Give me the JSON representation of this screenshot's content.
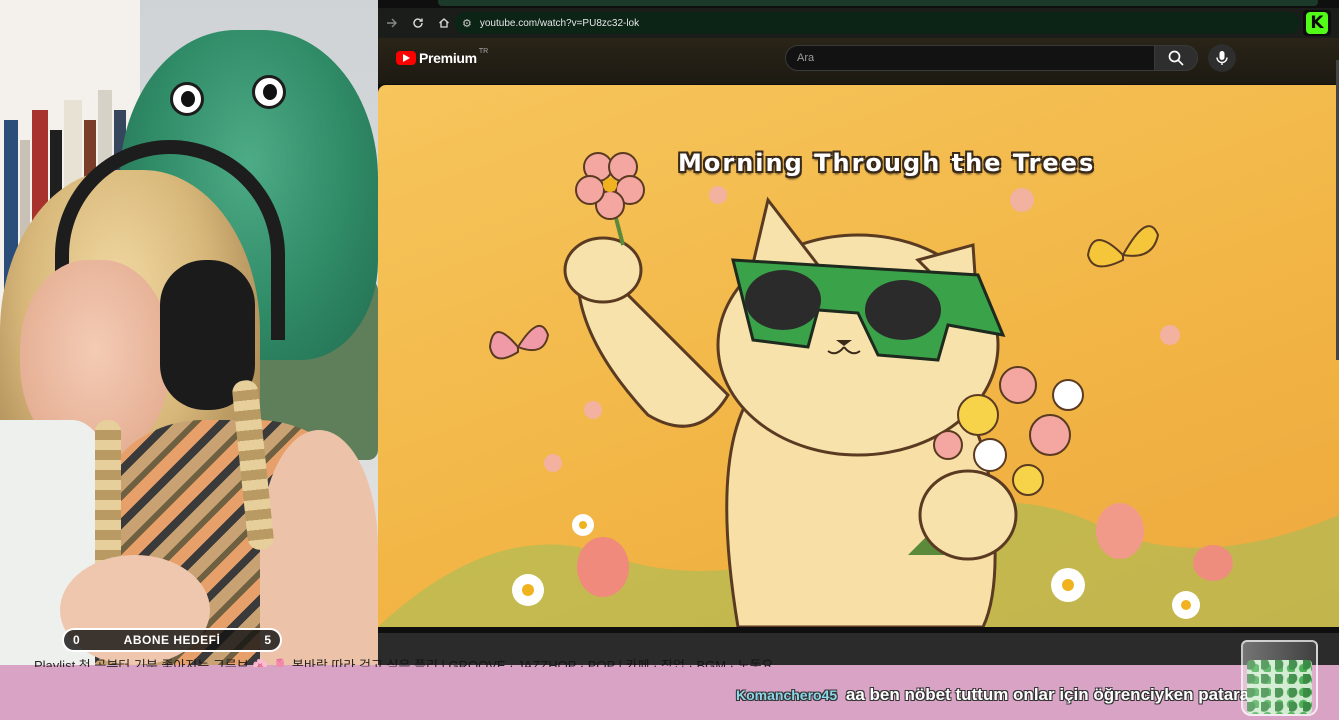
{
  "browser": {
    "url": "youtube.com/watch?v=PU8zc32-lok",
    "extension_label": "K"
  },
  "youtube": {
    "logo_text": "Premium",
    "region_code": "TR",
    "search": {
      "placeholder": "Ara"
    }
  },
  "video": {
    "thumbnail_title": "Morning Through the Trees",
    "title": "Playlist 첫 곡부터 기분 좋아지는 그루브 🌸 🌷 봄바람 따라 걷고 싶은 플리 | GROOVE · JAZZHOP · POP | 카페 · 작업 · BGM · 노동요"
  },
  "stream_overlay": {
    "goal": {
      "current": "0",
      "label": "ABONE HEDEFİ",
      "target": "5"
    },
    "chat": {
      "username": "Komanchero45",
      "message": "aa ben nöbet tuttum onlar için öğrenciyken patara da ."
    }
  },
  "colors": {
    "chat_band": "#d9a3c5",
    "video_background": "#f2b646",
    "youtube_red": "#ff0000",
    "kick_green": "#53fc18"
  }
}
